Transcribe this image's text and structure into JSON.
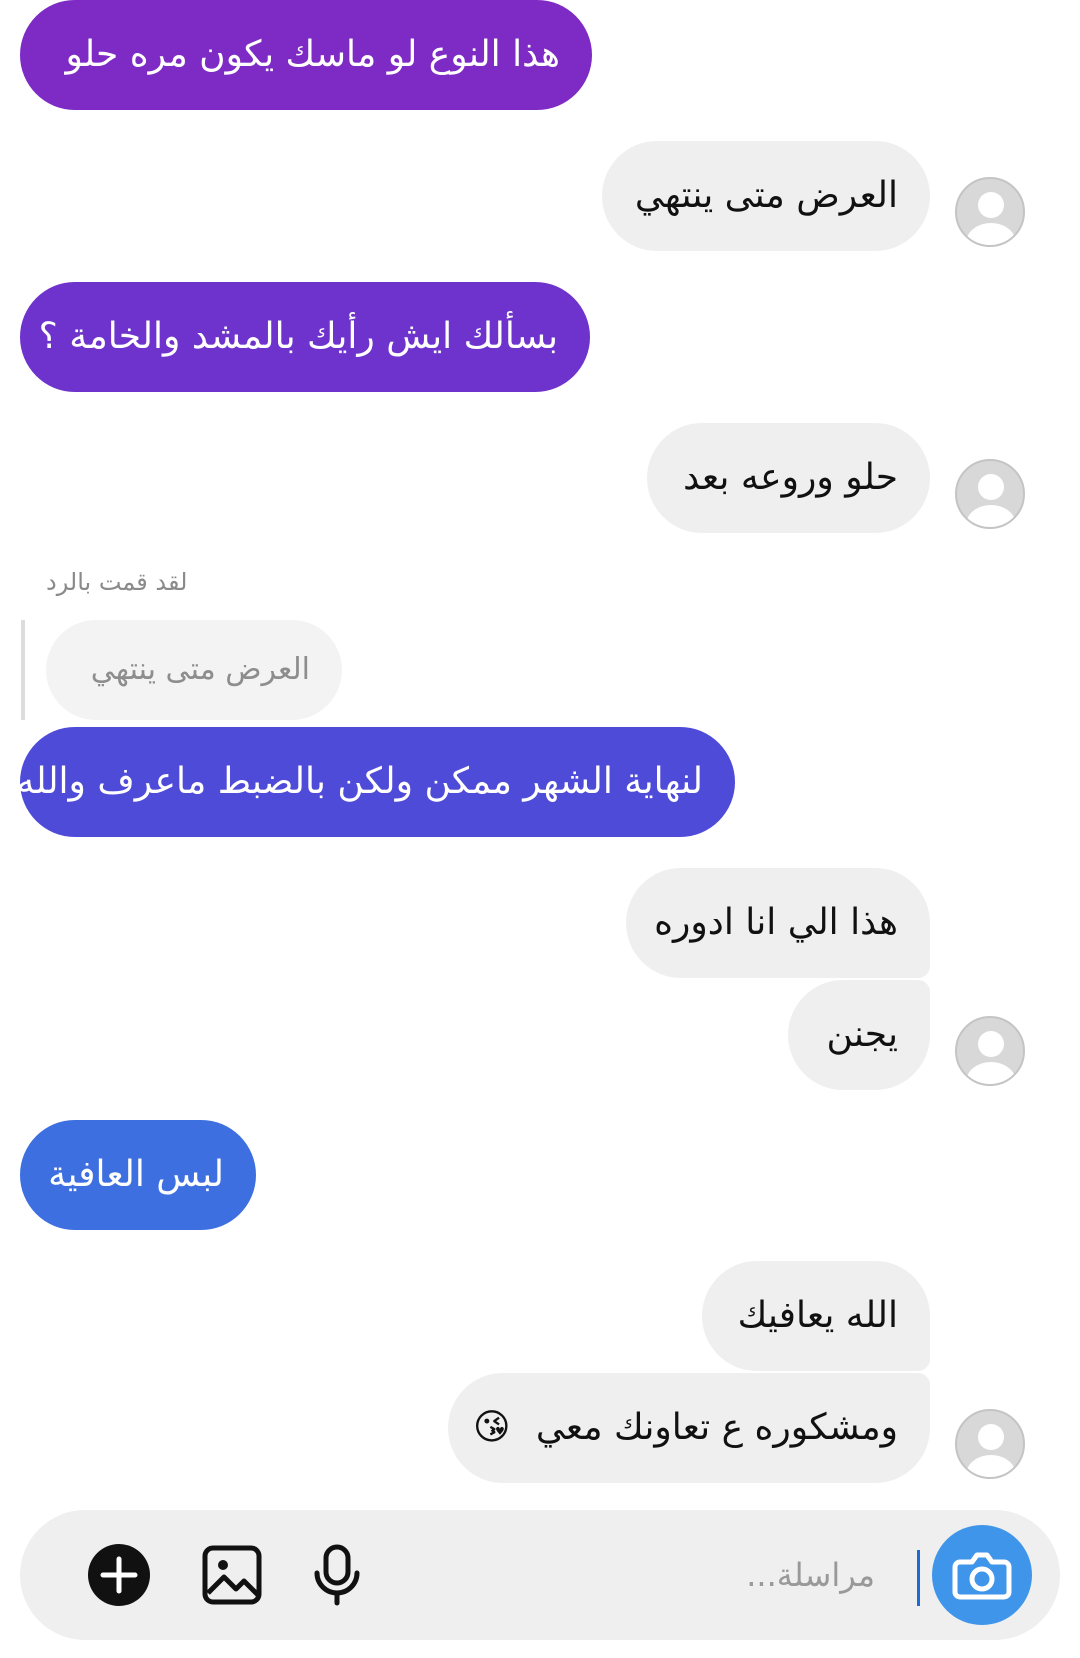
{
  "messages": [
    {
      "direction": "sent",
      "text": "هذا النوع لو ماسك يكون مره حلو",
      "color": "#7e2bc6"
    },
    {
      "direction": "received",
      "text": "العرض متى ينتهي"
    },
    {
      "direction": "sent",
      "text": "بسألك ايش رأيك بالمشد والخامة ؟",
      "color": "#6e33cc"
    },
    {
      "direction": "received",
      "text": "حلو وروعه بعد"
    },
    {
      "direction": "sent",
      "text": "لنهاية الشهر ممكن ولكن بالضبط ماعرف والله",
      "color": "#4f4bd9",
      "reply": {
        "label": "لقد قمت بالرد",
        "quoted_text": "العرض متى ينتهي"
      }
    },
    {
      "direction": "received",
      "text": "هذا الي انا ادوره"
    },
    {
      "direction": "received",
      "text": "يجنن"
    },
    {
      "direction": "sent",
      "text": "لبس العافية",
      "color": "#3d6fe0"
    },
    {
      "direction": "received",
      "text": "الله يعافيك"
    },
    {
      "direction": "received",
      "text": "ومشكوره ع تعاونك معي",
      "emoji": "😘"
    }
  ],
  "composer": {
    "placeholder": "مراسلة...",
    "icons": [
      "camera-icon",
      "microphone-icon",
      "gallery-icon",
      "add-icon"
    ],
    "camera_color": "#3f95ea"
  }
}
